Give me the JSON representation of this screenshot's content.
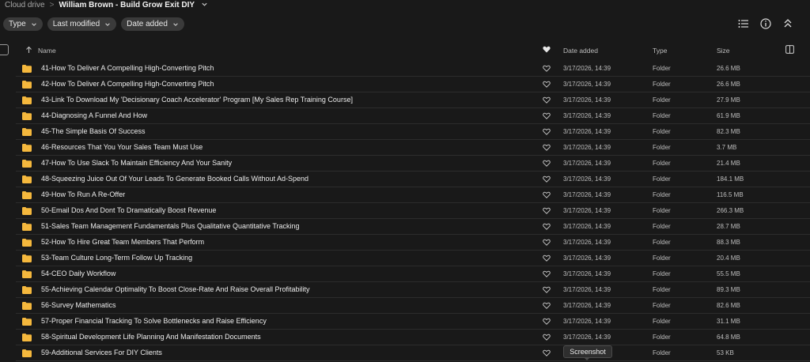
{
  "breadcrumb": {
    "root": "Cloud drive",
    "separator": ">",
    "current": "William Brown - Build Grow Exit DIY"
  },
  "filters": [
    {
      "label": "Type"
    },
    {
      "label": "Last modified"
    },
    {
      "label": "Date added"
    }
  ],
  "toolbar_icons": [
    "list-view-icon",
    "info-icon",
    "collapse-icon"
  ],
  "columns": {
    "name": "Name",
    "date_added": "Date added",
    "type": "Type",
    "size": "Size"
  },
  "rows": [
    {
      "name": "41-How To Deliver A Compelling High-Converting Pitch",
      "date": "3/17/2026, 14:39",
      "type": "Folder",
      "size": "26.6 MB"
    },
    {
      "name": "42-How To Deliver A Compelling High-Converting Pitch",
      "date": "3/17/2026, 14:39",
      "type": "Folder",
      "size": "26.6 MB"
    },
    {
      "name": "43-Link To Download My 'Decisionary Coach Accelerator' Program [My Sales Rep Training Course]",
      "date": "3/17/2026, 14:39",
      "type": "Folder",
      "size": "27.9 MB"
    },
    {
      "name": "44-Diagnosing A Funnel And How",
      "date": "3/17/2026, 14:39",
      "type": "Folder",
      "size": "61.9 MB"
    },
    {
      "name": "45-The Simple Basis Of Success",
      "date": "3/17/2026, 14:39",
      "type": "Folder",
      "size": "82.3 MB"
    },
    {
      "name": "46-Resources That You Your Sales Team Must Use",
      "date": "3/17/2026, 14:39",
      "type": "Folder",
      "size": "3.7 MB"
    },
    {
      "name": "47-How To Use Slack To Maintain Efficiency And Your Sanity",
      "date": "3/17/2026, 14:39",
      "type": "Folder",
      "size": "21.4 MB"
    },
    {
      "name": "48-Squeezing Juice Out Of Your Leads To Generate Booked Calls Without Ad-Spend",
      "date": "3/17/2026, 14:39",
      "type": "Folder",
      "size": "184.1 MB"
    },
    {
      "name": "49-How To Run A Re-Offer",
      "date": "3/17/2026, 14:39",
      "type": "Folder",
      "size": "116.5 MB"
    },
    {
      "name": "50-Email Dos And Dont To Dramatically Boost Revenue",
      "date": "3/17/2026, 14:39",
      "type": "Folder",
      "size": "266.3 MB"
    },
    {
      "name": "51-Sales Team Management Fundamentals Plus Qualitative Quantitative Tracking",
      "date": "3/17/2026, 14:39",
      "type": "Folder",
      "size": "28.7 MB"
    },
    {
      "name": "52-How To Hire Great Team Members That Perform",
      "date": "3/17/2026, 14:39",
      "type": "Folder",
      "size": "88.3 MB"
    },
    {
      "name": "53-Team Culture Long-Term Follow Up Tracking",
      "date": "3/17/2026, 14:39",
      "type": "Folder",
      "size": "20.4 MB"
    },
    {
      "name": "54-CEO Daily Workflow",
      "date": "3/17/2026, 14:39",
      "type": "Folder",
      "size": "55.5 MB"
    },
    {
      "name": "55-Achieving Calendar Optimality To Boost Close-Rate And Raise Overall Profitability",
      "date": "3/17/2026, 14:39",
      "type": "Folder",
      "size": "89.3 MB"
    },
    {
      "name": "56-Survey Mathematics",
      "date": "3/17/2026, 14:39",
      "type": "Folder",
      "size": "82.6 MB"
    },
    {
      "name": "57-Proper Financial Tracking To Solve Bottlenecks and Raise Efficiency",
      "date": "3/17/2026, 14:39",
      "type": "Folder",
      "size": "31.1 MB"
    },
    {
      "name": "58-Spiritual Development Life Planning And Manifestation Documents",
      "date": "3/17/2026, 14:39",
      "type": "Folder",
      "size": "64.8 MB"
    },
    {
      "name": "59-Additional Services For DIY Clients",
      "date": "",
      "type": "Folder",
      "size": "53 KB"
    }
  ],
  "tooltip": "Screenshot",
  "colors": {
    "background": "#191919",
    "chip": "#3a3a3a",
    "folder": "#f5b83d",
    "row_divider": "#2c2c2c"
  }
}
